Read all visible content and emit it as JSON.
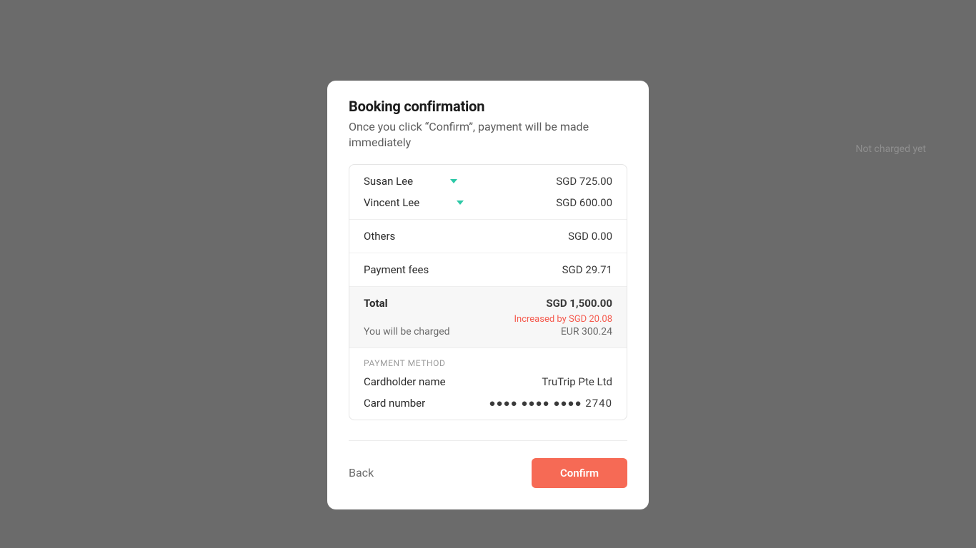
{
  "background": {
    "not_charged_text": "Not charged yet"
  },
  "modal": {
    "title": "Booking confirmation",
    "subtitle": "Once you click “Confirm”, payment will be made immediately",
    "travellers": [
      {
        "name": "Susan Lee",
        "amount": "SGD 725.00"
      },
      {
        "name": "Vincent Lee",
        "amount": "SGD 600.00"
      }
    ],
    "others_label": "Others",
    "others_amount": "SGD 0.00",
    "fees_label": "Payment fees",
    "fees_amount": "SGD 29.71",
    "total_label": "Total",
    "total_amount": "SGD 1,500.00",
    "increase_notice": "Increased by SGD 20.08",
    "charged_label": "You will be charged",
    "charged_amount": "EUR 300.24",
    "payment_method_header": "PAYMENT METHOD",
    "cardholder_label": "Cardholder name",
    "cardholder_value": "TruTrip Pte Ltd",
    "cardnumber_label": "Card number",
    "cardnumber_value": "●●●● ●●●● ●●●● 2740",
    "back_label": "Back",
    "confirm_label": "Confirm"
  }
}
